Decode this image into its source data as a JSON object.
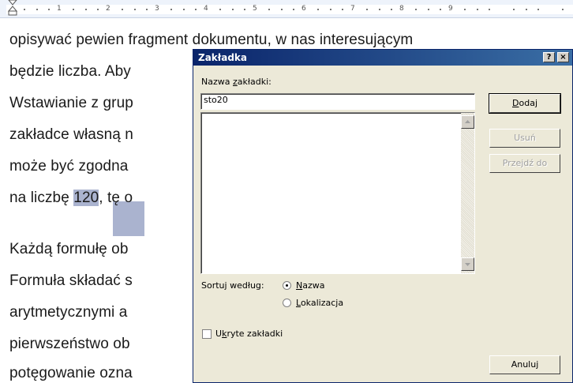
{
  "ruler": {
    "numbers": [
      "1",
      "2",
      "3",
      "4",
      "5",
      "6",
      "7",
      "8",
      "9"
    ]
  },
  "document": {
    "lines": [
      "opisywać pewien fragment dokumentu, w nas interesującym",
      "będzie liczba. Aby",
      "Wstawianie z grup",
      "zakładce własną n",
      "może być zgodna",
      "na liczbę ",
      "Każdą formułę ob",
      "Formuła składać s",
      "arytmetycznymi a",
      "pierwszeństwo ob",
      "potęgowanie ozna"
    ],
    "highlighted_number": "120",
    "line6_suffix": ", tę o"
  },
  "dialog": {
    "title": "Zakładka",
    "help_button": "?",
    "close_button": "×",
    "name_label": "Nazwa zakładki:",
    "name_value": "sto20",
    "buttons": {
      "add": "Dodaj",
      "delete": "Usuń",
      "goto": "Przejdź do",
      "cancel": "Anuluj"
    },
    "sort_label": "Sortuj według:",
    "sort_options": [
      "Nazwa",
      "Lokalizacja"
    ],
    "sort_selected": "Nazwa",
    "hidden_label": "Ukryte zakładki",
    "hidden_checked": false
  }
}
